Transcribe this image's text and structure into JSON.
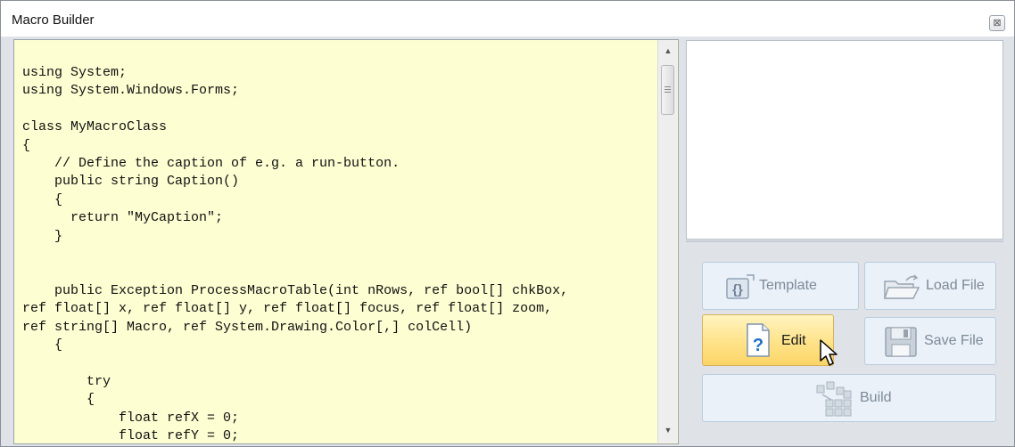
{
  "window": {
    "title": "Macro Builder",
    "close_glyph": "⊠"
  },
  "editor": {
    "code": "using System;\nusing System.Windows.Forms;\n\nclass MyMacroClass\n{\n    // Define the caption of e.g. a run-button.\n    public string Caption()\n    {\n      return \"MyCaption\";\n    }\n\n\n    public Exception ProcessMacroTable(int nRows, ref bool[] chkBox,\nref float[] x, ref float[] y, ref float[] focus, ref float[] zoom,\nref string[] Macro, ref System.Drawing.Color[,] colCell)\n    {\n\n        try\n        {\n            float refX = 0;\n            float refY = 0;"
  },
  "scrollbar": {
    "up_glyph": "▲",
    "down_glyph": "▼"
  },
  "buttons": {
    "template": {
      "label": "Template",
      "icon": "template-icon"
    },
    "load_file": {
      "label": "Load File",
      "icon": "folder-open-icon"
    },
    "edit": {
      "label": "Edit",
      "icon": "help-document-icon"
    },
    "save_file": {
      "label": "Save File",
      "icon": "floppy-disk-icon"
    },
    "build": {
      "label": "Build",
      "icon": "build-blocks-icon"
    }
  },
  "colors": {
    "editor_background": "#fefed3",
    "active_button": "#ffe38a",
    "disabled_text": "#7d8a99"
  }
}
